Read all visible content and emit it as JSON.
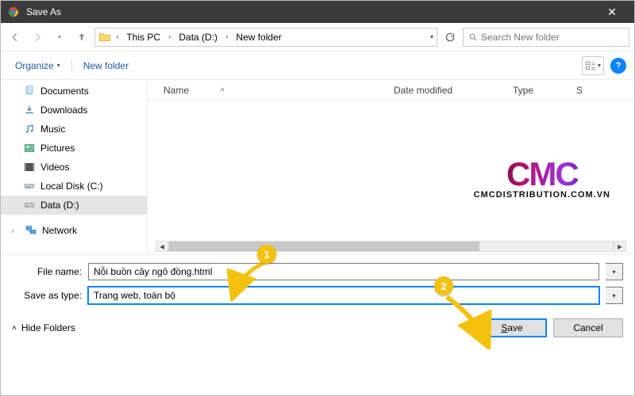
{
  "titlebar": {
    "title": "Save As"
  },
  "breadcrumbs": {
    "items": [
      "This PC",
      "Data (D:)",
      "New folder"
    ]
  },
  "search": {
    "placeholder": "Search New folder"
  },
  "toolbar": {
    "organize": "Organize",
    "newfolder": "New folder"
  },
  "tree": {
    "items": [
      {
        "icon": "doc",
        "label": "Documents"
      },
      {
        "icon": "down",
        "label": "Downloads"
      },
      {
        "icon": "music",
        "label": "Music"
      },
      {
        "icon": "pic",
        "label": "Pictures"
      },
      {
        "icon": "video",
        "label": "Videos"
      },
      {
        "icon": "disk",
        "label": "Local Disk (C:)"
      },
      {
        "icon": "disk",
        "label": "Data (D:)",
        "selected": true
      }
    ],
    "network": "Network"
  },
  "columns": {
    "name": "Name",
    "date": "Date modified",
    "type": "Type",
    "size": "S"
  },
  "fields": {
    "filename_label": "File name:",
    "filename_value": "Nỗi buồn cây ngô đồng.html",
    "savetype_label": "Save as type:",
    "savetype_value": "Trang web, toàn bộ"
  },
  "bottom": {
    "hidefolders": "Hide Folders",
    "save": "Save",
    "cancel": "Cancel"
  },
  "annotations": {
    "marker1": "1",
    "marker2": "2"
  },
  "watermark": {
    "big": "CMC",
    "small": "CMCDISTRIBUTION.COM.VN"
  }
}
